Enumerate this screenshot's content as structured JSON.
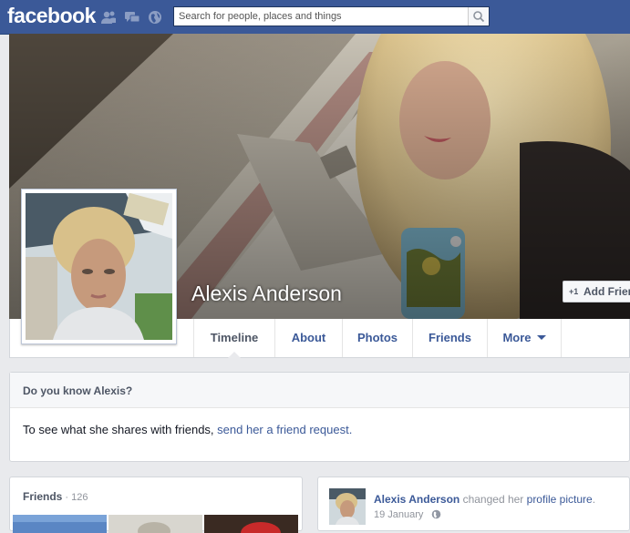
{
  "header": {
    "logo": "facebook",
    "search_placeholder": "Search for people, places and things"
  },
  "icons": [
    "friend-requests-icon",
    "messages-icon",
    "notifications-globe-icon",
    "search-icon",
    "add-friend-icon",
    "privacy-globe-icon"
  ],
  "colors": {
    "brand": "#3b5998",
    "link": "#3b5998",
    "muted": "#90949c"
  },
  "profile": {
    "name": "Alexis Anderson",
    "add_friend_icon_text": "+1",
    "add_friend_label": "Add Friend"
  },
  "nav": {
    "tabs": [
      {
        "label": "Timeline",
        "active": true
      },
      {
        "label": "About"
      },
      {
        "label": "Photos"
      },
      {
        "label": "Friends"
      },
      {
        "label": "More"
      }
    ]
  },
  "know_box": {
    "title": "Do you know Alexis?",
    "text": "To see what she shares with friends, ",
    "link": "send her a friend request."
  },
  "friends_box": {
    "title": "Friends",
    "separator": " · ",
    "count": "126"
  },
  "story": {
    "author": "Alexis Anderson",
    "action": " changed her ",
    "object": "profile picture",
    "period": ".",
    "date": "19 January"
  }
}
